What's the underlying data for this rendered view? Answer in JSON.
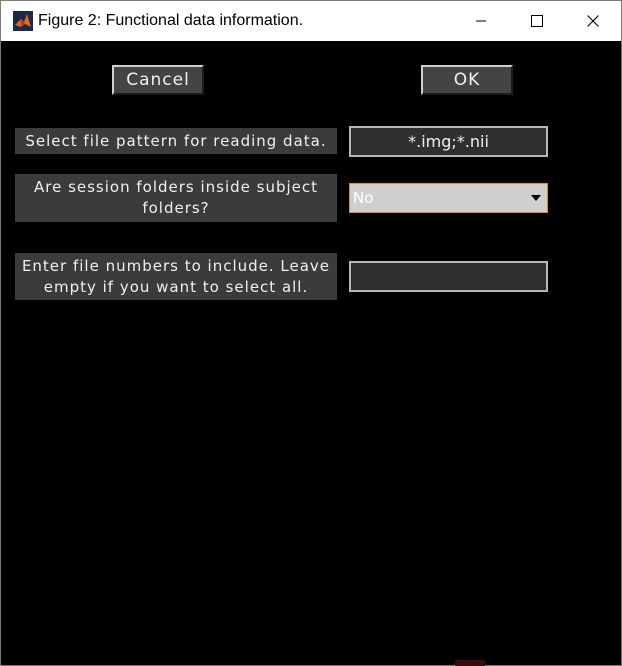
{
  "window": {
    "title": "Figure 2: Functional data information."
  },
  "buttons": {
    "cancel_label": "Cancel",
    "ok_label": "OK"
  },
  "fields": {
    "pattern": {
      "label": "Select file pattern for reading data.",
      "value": "*.img;*.nii"
    },
    "session_folders": {
      "label": "Are session folders inside subject folders?",
      "selected": "No"
    },
    "file_numbers": {
      "label": "Enter file numbers to include. Leave empty if you want to select all.",
      "value": ""
    }
  },
  "icons": {
    "app": "matlab-icon",
    "minimize": "minimize-icon",
    "maximize": "maximize-icon",
    "close": "close-icon",
    "dropdown": "chevron-down-icon"
  },
  "colors": {
    "background": "#000000",
    "label_bg": "#3b3b3b",
    "dropdown_border": "#d98f2a"
  }
}
